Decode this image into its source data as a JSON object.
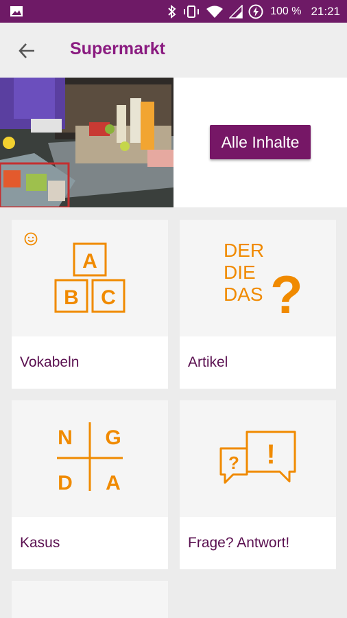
{
  "status_bar": {
    "battery_text": "100 %",
    "time": "21:21"
  },
  "app_bar": {
    "title": "Supermarkt",
    "back_icon": "arrow-left-icon"
  },
  "hero": {
    "image": "supermarket-checkout-photo",
    "button_label": "Alle Inhalte"
  },
  "tiles": [
    {
      "label": "Vokabeln",
      "icon": "abc-blocks-icon",
      "letters": [
        "A",
        "B",
        "C"
      ]
    },
    {
      "label": "Artikel",
      "icon": "der-die-das-icon",
      "letters": [
        "DER",
        "DIE",
        "DAS",
        "?"
      ]
    },
    {
      "label": "Kasus",
      "icon": "ngda-icon",
      "letters": [
        "N",
        "G",
        "D",
        "A"
      ]
    },
    {
      "label": "Frage? Antwort!",
      "icon": "speech-bubbles-icon",
      "letters": [
        "?",
        "!"
      ]
    }
  ],
  "colors": {
    "status_bar": "#6e1a66",
    "title": "#8a1b80",
    "button": "#761766",
    "icon_orange": "#f08a00",
    "label": "#5a1050"
  }
}
